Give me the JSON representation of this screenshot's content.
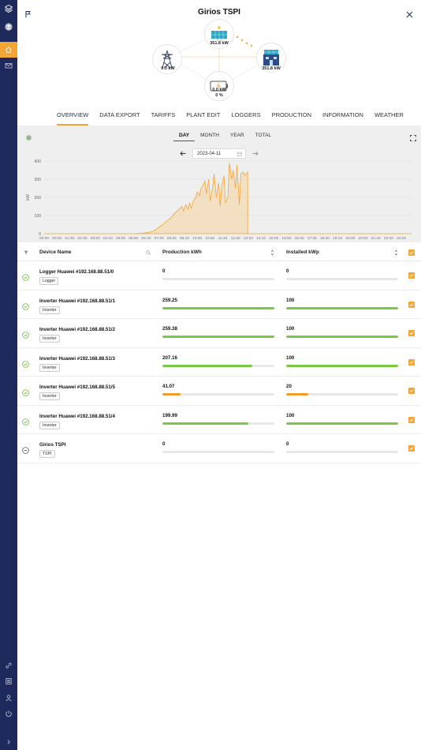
{
  "app": {
    "title": "Girios TSPI"
  },
  "colors": {
    "rail": "#1f2a5c",
    "accent": "#f3a536",
    "green": "#7ac943",
    "orange": "#f39c2b"
  },
  "sidebar": {
    "top_icons": [
      "logo-icon",
      "user-avatar-icon",
      "home-icon",
      "mail-icon"
    ],
    "bottom_icons": [
      "link-icon",
      "list-icon",
      "person-icon",
      "power-icon",
      "chevron-right-icon"
    ]
  },
  "diagram": {
    "solar_value": "351.8 kW",
    "grid_value": "0.0 kW",
    "home_value": "351.8 kW",
    "battery_value": "0.0 kW",
    "battery_percent": "0 %"
  },
  "tabs": [
    "OVERVIEW",
    "DATA EXPORT",
    "TARIFFS",
    "PLANT EDIT",
    "LOGGERS",
    "PRODUCTION",
    "INFORMATION",
    "WEATHER"
  ],
  "active_tab": "OVERVIEW",
  "periods": [
    "DAY",
    "MONTH",
    "YEAR",
    "TOTAL"
  ],
  "active_period": "DAY",
  "date": "2023-04-11",
  "chart_data": {
    "type": "area",
    "ylabel": "kW",
    "ylim": [
      0,
      400
    ],
    "yticks": [
      0,
      100,
      200,
      300,
      400
    ],
    "x_tick_labels": [
      "00:00",
      "00:50",
      "01:40",
      "02:30",
      "03:20",
      "04:10",
      "05:00",
      "05:50",
      "06:40",
      "07:30",
      "08:20",
      "09:10",
      "10:00",
      "10:50",
      "11:40",
      "12:30",
      "13:20",
      "14:10",
      "15:00",
      "15:50",
      "16:40",
      "17:30",
      "18:20",
      "19:10",
      "20:00",
      "20:50",
      "21:40",
      "22:30",
      "23:20"
    ],
    "x_hours": [
      6.0,
      6.5,
      7.0,
      7.25,
      7.5,
      7.75,
      8.0,
      8.25,
      8.5,
      8.75,
      9.0,
      9.1,
      9.25,
      9.4,
      9.5,
      9.6,
      9.75,
      9.9,
      10.0,
      10.15,
      10.25,
      10.4,
      10.5,
      10.6,
      10.75,
      10.85,
      11.0,
      11.1,
      11.25,
      11.4,
      11.5,
      11.6,
      11.75,
      11.85,
      12.0,
      12.1,
      12.25,
      12.35,
      12.5,
      12.6,
      12.75,
      12.85,
      13.0,
      13.1,
      13.2,
      13.3,
      13.3
    ],
    "values": [
      0,
      3,
      10,
      20,
      35,
      50,
      70,
      85,
      110,
      130,
      150,
      125,
      160,
      135,
      170,
      140,
      180,
      200,
      230,
      210,
      250,
      270,
      290,
      220,
      300,
      180,
      250,
      330,
      200,
      280,
      150,
      260,
      320,
      170,
      200,
      390,
      300,
      350,
      250,
      380,
      160,
      330,
      340,
      320,
      330,
      340,
      0
    ],
    "grid": true
  },
  "table": {
    "headers": {
      "name": "Device Name",
      "production": "Production kWh",
      "installed": "Installed kWp"
    },
    "rows": [
      {
        "name": "Logger Huawei #192.168.88.51/0",
        "type": "Logger",
        "production": "0",
        "production_frac": 0,
        "installed": "0",
        "installed_frac": 0,
        "status": "ok",
        "prod_color": "green",
        "inst_color": "green"
      },
      {
        "name": "Inverter Huawei #192.168.88.51/1",
        "type": "Inverter",
        "production": "259.25",
        "production_frac": 1.0,
        "installed": "100",
        "installed_frac": 1.0,
        "status": "ok",
        "prod_color": "green",
        "inst_color": "green"
      },
      {
        "name": "Inverter Huawei #192.168.88.51/2",
        "type": "Inverter",
        "production": "259.38",
        "production_frac": 1.0,
        "installed": "100",
        "installed_frac": 1.0,
        "status": "ok",
        "prod_color": "green",
        "inst_color": "green"
      },
      {
        "name": "Inverter Huawei #192.168.88.51/3",
        "type": "Inverter",
        "production": "207.16",
        "production_frac": 0.8,
        "installed": "100",
        "installed_frac": 1.0,
        "status": "ok",
        "prod_color": "green",
        "inst_color": "green"
      },
      {
        "name": "Inverter Huawei #192.168.88.51/5",
        "type": "Inverter",
        "production": "41.07",
        "production_frac": 0.16,
        "installed": "20",
        "installed_frac": 0.2,
        "status": "ok",
        "prod_color": "orange",
        "inst_color": "orange"
      },
      {
        "name": "Inverter Huawei #192.168.88.51/4",
        "type": "Inverter",
        "production": "199.99",
        "production_frac": 0.77,
        "installed": "100",
        "installed_frac": 1.0,
        "status": "ok",
        "prod_color": "green",
        "inst_color": "green"
      },
      {
        "name": "Girios TSPI",
        "type": "TSPI",
        "production": "0",
        "production_frac": 0,
        "installed": "0",
        "installed_frac": 0,
        "status": "neutral",
        "prod_color": "green",
        "inst_color": "green"
      }
    ]
  }
}
